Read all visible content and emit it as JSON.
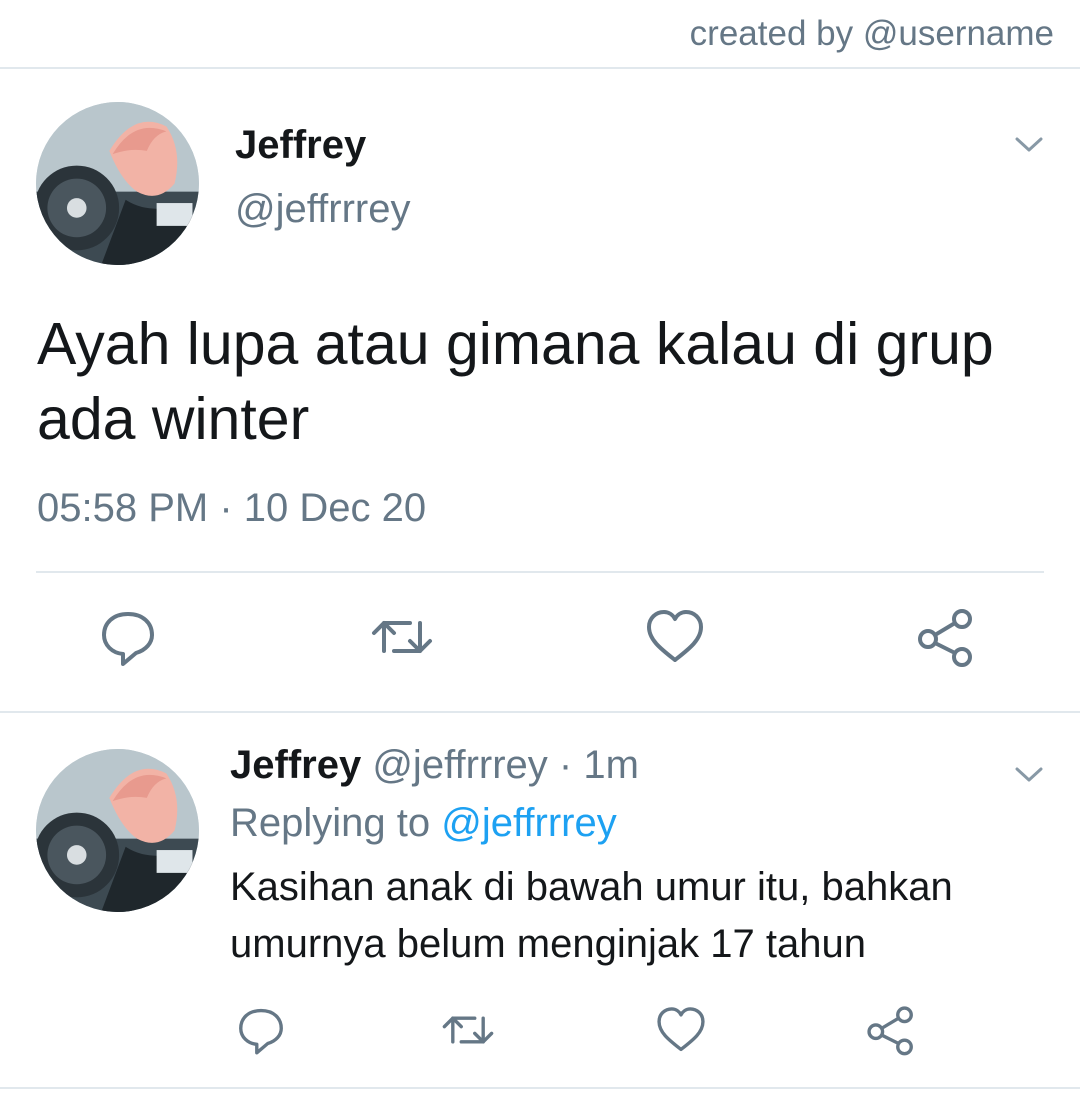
{
  "credit": "created by @username",
  "main_tweet": {
    "name": "Jeffrey",
    "handle": "@jeffrrrey",
    "text": "Ayah lupa atau gimana kalau di grup ada winter",
    "timestamp": "05:58 PM · 10 Dec 20",
    "actions": {
      "reply_icon": "comment-bubble-icon",
      "retweet_icon": "retweet-icon",
      "like_icon": "heart-icon",
      "share_icon": "share-icon"
    }
  },
  "reply_tweet": {
    "name": "Jeffrey",
    "handle_time": "@jeffrrrey · 1m",
    "replying_label": "Replying to",
    "replying_to": "@jeffrrrey",
    "text": "Kasihan anak di bawah umur itu, bahkan umurnya belum menginjak 17 tahun"
  },
  "colors": {
    "text": "#14171a",
    "secondary": "#657786",
    "accent": "#1da1f2",
    "divider": "#e1e8ed"
  }
}
